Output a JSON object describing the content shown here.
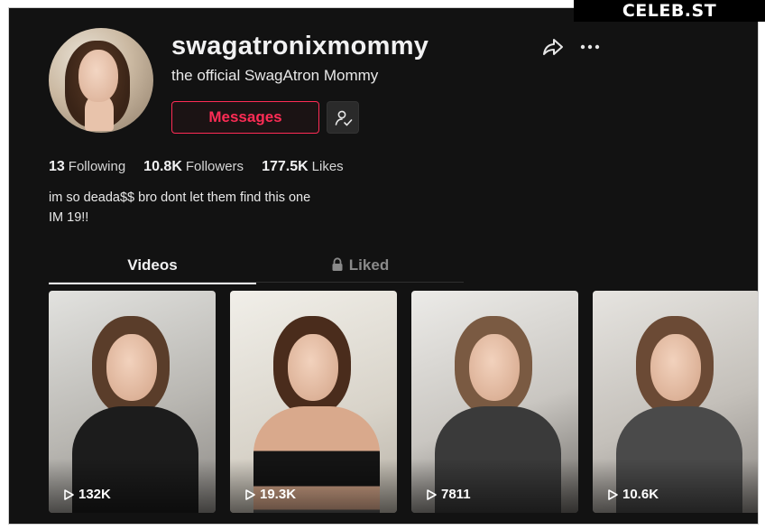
{
  "watermark": "CELEB.ST",
  "profile": {
    "username": "swagatronixmommy",
    "display_name": "the official SwagAtron Mommy",
    "messages_label": "Messages",
    "stats": [
      {
        "value": "13",
        "label": "Following"
      },
      {
        "value": "10.8K",
        "label": "Followers"
      },
      {
        "value": "177.5K",
        "label": "Likes"
      }
    ],
    "bio_lines": [
      "im so deada$$ bro dont let them find this one",
      "IM 19!!"
    ]
  },
  "icons": {
    "share": "share-icon",
    "more": "more-icon",
    "follow_suggest": "user-check-icon",
    "lock": "lock-icon",
    "play": "play-icon"
  },
  "tabs": [
    {
      "label": "Videos",
      "active": true
    },
    {
      "label": "Liked",
      "active": false,
      "locked": true
    }
  ],
  "videos": [
    {
      "views": "132K"
    },
    {
      "views": "19.3K"
    },
    {
      "views": "7811"
    },
    {
      "views": "10.6K"
    }
  ],
  "colors": {
    "accent": "#fe2c55",
    "background": "#121212",
    "text": "#f1f1f2"
  }
}
